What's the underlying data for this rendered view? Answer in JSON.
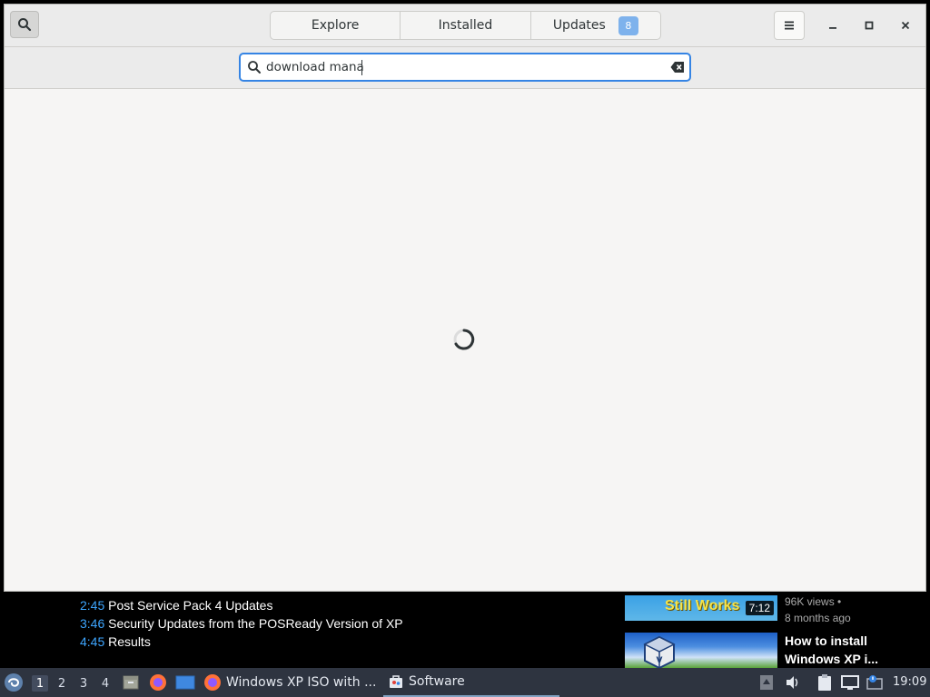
{
  "window": {
    "tabs": [
      {
        "label": "Explore"
      },
      {
        "label": "Installed"
      },
      {
        "label": "Updates",
        "badge": "8"
      }
    ],
    "search": {
      "value": "download mana",
      "placeholder": ""
    },
    "status": "loading"
  },
  "video": {
    "chapters": [
      {
        "time": "2:45",
        "title": "Post Service Pack 4 Updates"
      },
      {
        "time": "3:46",
        "title": "Security Updates from the POSReady Version of XP"
      },
      {
        "time": "4:45",
        "title": "Results"
      }
    ],
    "recommended": [
      {
        "thumb_text": "Still Works",
        "duration": "7:12",
        "views": "96K views •",
        "age": "8 months ago"
      },
      {
        "title_line1": "How to install",
        "title_line2": "Windows XP i..."
      }
    ]
  },
  "taskbar": {
    "workspaces": [
      "1",
      "2",
      "3",
      "4"
    ],
    "active_workspace": "1",
    "tasks": [
      {
        "label": "Windows XP ISO with ..."
      },
      {
        "label": "Software"
      }
    ],
    "clock": "19:09"
  },
  "colors": {
    "accent": "#3584e4",
    "badge": "#7eb2ec",
    "chapter_time": "#3ea6ff",
    "taskbar": "#2e3440"
  }
}
